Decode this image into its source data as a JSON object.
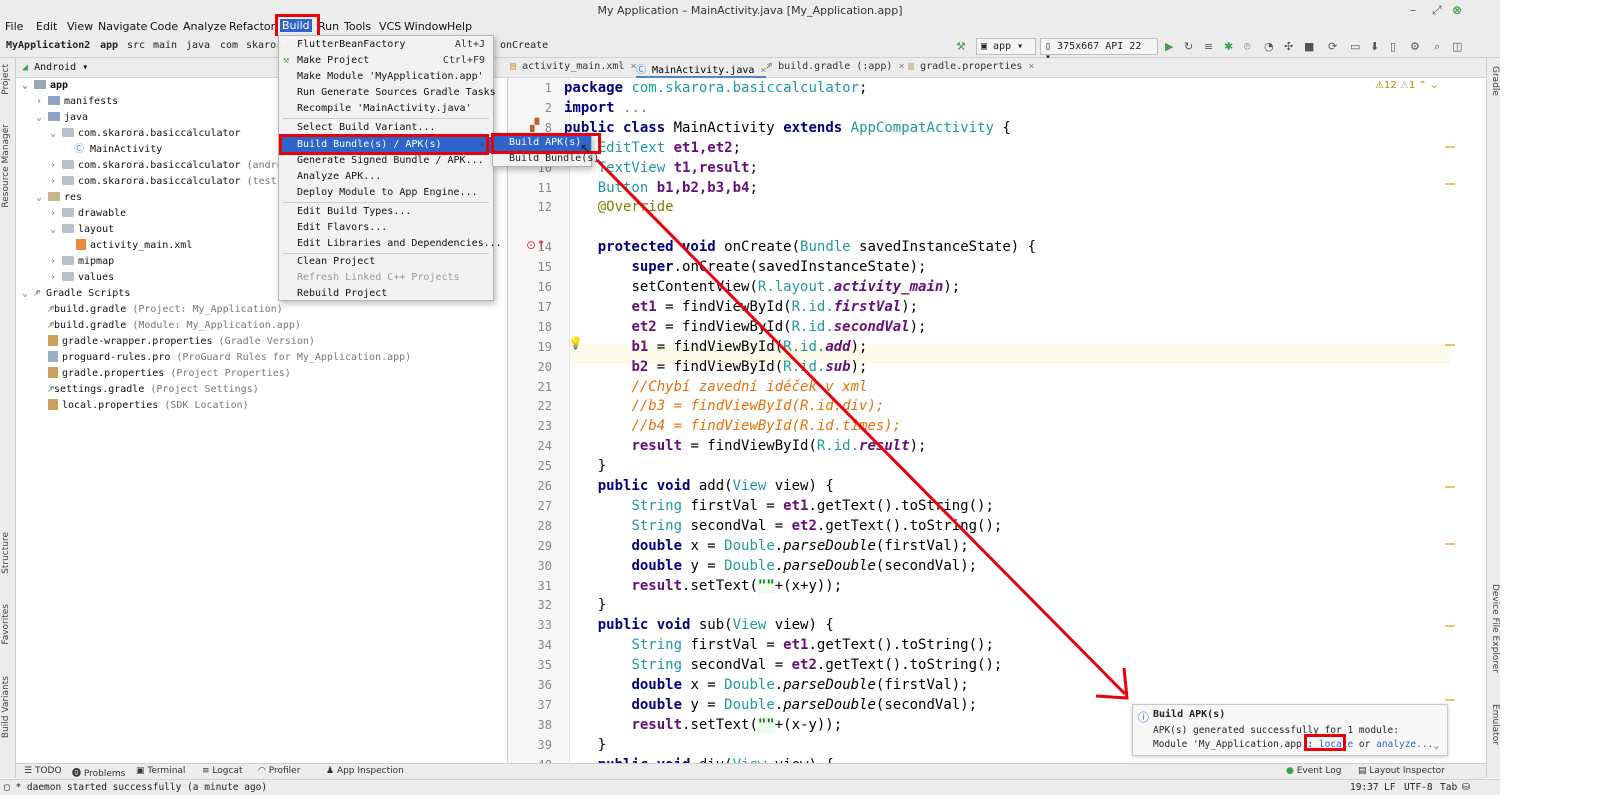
{
  "window": {
    "title": "My Application – MainActivity.java [My_Application.app]"
  },
  "menubar": [
    "File",
    "Edit",
    "View",
    "Navigate",
    "Code",
    "Analyze",
    "Refactor",
    "Build",
    "Run",
    "Tools",
    "VCS",
    "Window",
    "Help"
  ],
  "breadcrumbs": [
    "MyApplication2",
    "app",
    "src",
    "main",
    "java",
    "com",
    "skaror"
  ],
  "breadcrumb_tail": "onCreate",
  "toolbar": {
    "config": "app",
    "device": "375x667 API 22"
  },
  "project": {
    "view": "Android",
    "tree": [
      {
        "label": "app",
        "hint": ""
      },
      {
        "label": "manifests",
        "hint": ""
      },
      {
        "label": "java",
        "hint": ""
      },
      {
        "label": "com.skarora.basiccalculator",
        "hint": ""
      },
      {
        "label": "MainActivity",
        "hint": ""
      },
      {
        "label": "com.skarora.basiccalculator",
        "hint": "(androidTe"
      },
      {
        "label": "com.skarora.basiccalculator",
        "hint": "(test)"
      },
      {
        "label": "res",
        "hint": ""
      },
      {
        "label": "drawable",
        "hint": ""
      },
      {
        "label": "layout",
        "hint": ""
      },
      {
        "label": "activity_main.xml",
        "hint": ""
      },
      {
        "label": "mipmap",
        "hint": ""
      },
      {
        "label": "values",
        "hint": ""
      },
      {
        "label": "Gradle Scripts",
        "hint": ""
      },
      {
        "label": "build.gradle",
        "hint": "(Project: My_Application)"
      },
      {
        "label": "build.gradle",
        "hint": "(Module: My_Application.app)"
      },
      {
        "label": "gradle-wrapper.properties",
        "hint": "(Gradle Version)"
      },
      {
        "label": "proguard-rules.pro",
        "hint": "(ProGuard Rules for My_Application.app)"
      },
      {
        "label": "gradle.properties",
        "hint": "(Project Properties)"
      },
      {
        "label": "settings.gradle",
        "hint": "(Project Settings)"
      },
      {
        "label": "local.properties",
        "hint": "(SDK Location)"
      }
    ]
  },
  "editor_tabs": [
    "activity_main.xml",
    "MainActivity.java",
    "build.gradle (:app)",
    "gradle.properties"
  ],
  "inspection": {
    "warnings": "12",
    "weak": "1"
  },
  "line_numbers": [
    "1",
    "2",
    "8",
    "9",
    "10",
    "11",
    "12",
    "",
    "14",
    "15",
    "16",
    "17",
    "18",
    "19",
    "20",
    "21",
    "22",
    "23",
    "24",
    "25",
    "26",
    "27",
    "28",
    "29",
    "30",
    "31",
    "32",
    "33",
    "34",
    "35",
    "36",
    "37",
    "38",
    "39",
    "40"
  ],
  "code": {
    "l1_kw": "package",
    "l1_pkg": "com.skarora.basiccalculator",
    "l1_end": ";",
    "l2_kw": "import",
    "l2_fold": "...",
    "l3_kw1": "public class",
    "l3_name": "MainActivity",
    "l3_kw2": "extends",
    "l3_type": "AppCompatActivity",
    "l3_end": "{",
    "l4_type": "EditText",
    "l4_fields": "et1,et2",
    "l4_end": ";",
    "l5_type": "TextView",
    "l5_fields": "t1,result",
    "l5_end": ";",
    "l6_type": "Button",
    "l6_fields": "b1,b2,b3,b4",
    "l6_end": ";",
    "l7_ann": "@Override",
    "l8_kw": "protected void",
    "l8_name": "onCreate(",
    "l8_type": "Bundle",
    "l8_rest": "savedInstanceState) {",
    "l9_kw": "super",
    ".l9": "",
    "l9_rest": ".onCreate(savedInstanceState);",
    "l10_a": "setContentView(",
    "l10_r": "R",
    "l10_b": ".layout.",
    "l10_f": "activity_main",
    "l10_c": ");",
    "l11_f": "et1",
    "l11_a": " = findViewById(",
    "l11_r": "R",
    "l11_b": ".id.",
    "l11_i": "firstVal",
    "l11_c": ");",
    "l12_f": "et2",
    "l12_a": " = findViewById(",
    "l12_r": "R",
    "l12_b": ".id.",
    "l12_i": "secondVal",
    "l12_c": ");",
    "l13_f": "b1",
    "l13_a": " = findViewById(",
    "l13_r": "R",
    "l13_b": ".id.",
    "l13_i": "add",
    "l13_c": ");",
    "l14_f": "b2",
    "l14_a": " = findViewById(",
    "l14_r": "R",
    "l14_b": ".id.",
    "l14_i": "sub",
    "l14_c": ");",
    "l15_com": "//Chybí zavední idéček v xml",
    "l16_com": "//b3 = findViewById(R.id.div);",
    "l17_com": "//b4 = findViewById(R.id.times);",
    "l18_f": "result",
    "l18_a": " = findViewById(",
    "l18_r": "R",
    "l18_b": ".id.",
    "l18_i": "result",
    "l18_c": ");",
    "l19": "}",
    "l20_kw": "public void",
    "l20_rest": " add(",
    "l20_type": "View",
    "l20_end": " view) {",
    "l21_type": "String",
    "l21_a": " firstVal = ",
    "l21_f": "et1",
    "l21_b": ".getText().toString();",
    "l22_type": "String",
    "l22_a": " secondVal = ",
    "l22_f": "et2",
    "l22_b": ".getText().toString();",
    "l23_kw": "double",
    "l23_a": " x = ",
    "l23_type": "Double",
    "l23_b": ".",
    "l23_s": "parseDouble",
    "l23_c": "(firstVal);",
    "l24_kw": "double",
    "l24_a": " y = ",
    "l24_type": "Double",
    "l24_b": ".",
    "l24_s": "parseDouble",
    "l24_c": "(secondVal);",
    "l25_f": "result",
    "l25_a": ".setText(",
    "l25_str": "\"\"",
    "l25_b": "+(x+y));",
    "l26": "}",
    "l27_kw": "public void",
    "l27_rest": " sub(",
    "l27_type": "View",
    "l27_end": " view) {",
    "l28_type": "String",
    "l28_a": " firstVal = ",
    "l28_f": "et1",
    "l28_b": ".getText().toString();",
    "l29_type": "String",
    "l29_a": " secondVal = ",
    "l29_f": "et2",
    "l29_b": ".getText().toString();",
    "l30_kw": "double",
    "l30_a": " x = ",
    "l30_type": "Double",
    "l30_b": ".",
    "l30_s": "parseDouble",
    "l30_c": "(firstVal);",
    "l31_kw": "double",
    "l31_a": " y = ",
    "l31_type": "Double",
    "l31_b": ".",
    "l31_s": "parseDouble",
    "l31_c": "(secondVal);",
    "l32_f": "result",
    "l32_a": ".setText(",
    "l32_str": "\"\"",
    "l32_b": "+(x-y));",
    "l33": "}",
    "l34_kw": "public void",
    "l34_rest": " div(",
    "l34_type": "View",
    "l34_end": " view) {"
  },
  "build_menu": {
    "items": [
      {
        "label": "FlutterBeanFactory",
        "shortcut": "Alt+J"
      },
      {
        "label": "Make Project",
        "shortcut": "Ctrl+F9"
      },
      {
        "label": "Make Module 'MyApplication.app'",
        "shortcut": ""
      },
      {
        "label": "Run Generate Sources Gradle Tasks",
        "shortcut": ""
      },
      {
        "label": "Recompile 'MainActivity.java'",
        "shortcut": ""
      },
      {
        "label": "Select Build Variant...",
        "shortcut": ""
      },
      {
        "label": "Build Bundle(s) / APK(s)",
        "shortcut": ""
      },
      {
        "label": "Generate Signed Bundle / APK...",
        "shortcut": ""
      },
      {
        "label": "Analyze APK...",
        "shortcut": ""
      },
      {
        "label": "Deploy Module to App Engine...",
        "shortcut": ""
      },
      {
        "label": "Edit Build Types...",
        "shortcut": ""
      },
      {
        "label": "Edit Flavors...",
        "shortcut": ""
      },
      {
        "label": "Edit Libraries and Dependencies...",
        "shortcut": ""
      },
      {
        "label": "Clean Project",
        "shortcut": ""
      },
      {
        "label": "Refresh Linked C++ Projects",
        "shortcut": ""
      },
      {
        "label": "Rebuild Project",
        "shortcut": ""
      }
    ],
    "submenu": [
      "Build APK(s)",
      "Build Bundle(s)"
    ]
  },
  "notification": {
    "title": "Build APK(s)",
    "line1": "APK(s) generated successfully for 1 module:",
    "line2": "Module 'My_Application.app': ",
    "locate": "locate",
    "or": " or ",
    "analyze": "analyze..."
  },
  "bottom_tabs": [
    "TODO",
    "Problems",
    "Terminal",
    "Logcat",
    "Profiler",
    "App Inspection",
    "Event Log",
    "Layout Inspector"
  ],
  "left_tabs": [
    "Project",
    "Resource Manager",
    "Structure",
    "Favorites",
    "Build Variants"
  ],
  "right_tabs": [
    "Gradle",
    "Device File Explorer",
    "Emulator"
  ],
  "status": {
    "message": "* daemon started successfully (a minute ago)",
    "position": "19:37",
    "line_sep": "LF",
    "encoding": "UTF-8",
    "indent": "Tab"
  },
  "colors": {
    "accent": "#2f65ca",
    "highlight_red": "#e8000b"
  }
}
